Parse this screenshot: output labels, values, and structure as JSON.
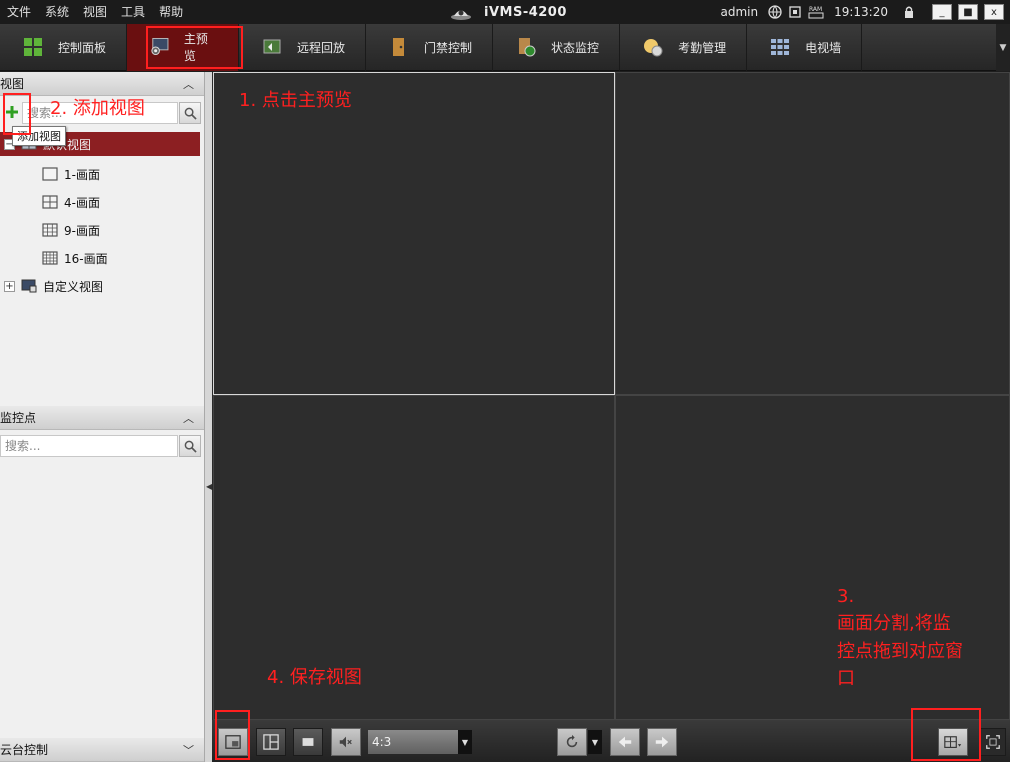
{
  "menu": [
    "文件",
    "系统",
    "视图",
    "工具",
    "帮助"
  ],
  "app_title": "iVMS-4200",
  "status": {
    "user": "admin",
    "time": "19:13:20"
  },
  "window_buttons": {
    "minimize": "_",
    "maximize": "■",
    "close": "x"
  },
  "tabs": [
    {
      "label": "控制面板",
      "icon": "control-panel-icon"
    },
    {
      "label": "主预览",
      "icon": "main-preview-icon",
      "active": true
    },
    {
      "label": "远程回放",
      "icon": "remote-playback-icon"
    },
    {
      "label": "门禁控制",
      "icon": "access-control-icon"
    },
    {
      "label": "状态监控",
      "icon": "status-monitor-icon"
    },
    {
      "label": "考勤管理",
      "icon": "attendance-icon"
    },
    {
      "label": "电视墙",
      "icon": "video-wall-icon"
    }
  ],
  "view_panel": {
    "title": "视图",
    "search_placeholder": "搜索...",
    "tooltip": "添加视图",
    "tree": {
      "default_view": "默认视图",
      "children": [
        "1-画面",
        "4-画面",
        "9-画面",
        "16-画面"
      ],
      "custom_view": "自定义视图"
    }
  },
  "camera_panel": {
    "title": "监控点",
    "search_placeholder": "搜索..."
  },
  "ptz_panel": {
    "title": "云台控制"
  },
  "controls": {
    "aspect_ratio": "4:3"
  },
  "annotations": {
    "step1": "1. 点击主预览",
    "step2": "2. 添加视图",
    "step3_line1": "3.",
    "step3_line2": "画面分割,将监",
    "step3_line3": "控点拖到对应窗",
    "step3_line4": "口",
    "step4": "4. 保存视图"
  },
  "colors": {
    "accent_red": "#ff1f1f",
    "active_tab": "#6a0f10",
    "selected_row": "#8c1f22"
  }
}
